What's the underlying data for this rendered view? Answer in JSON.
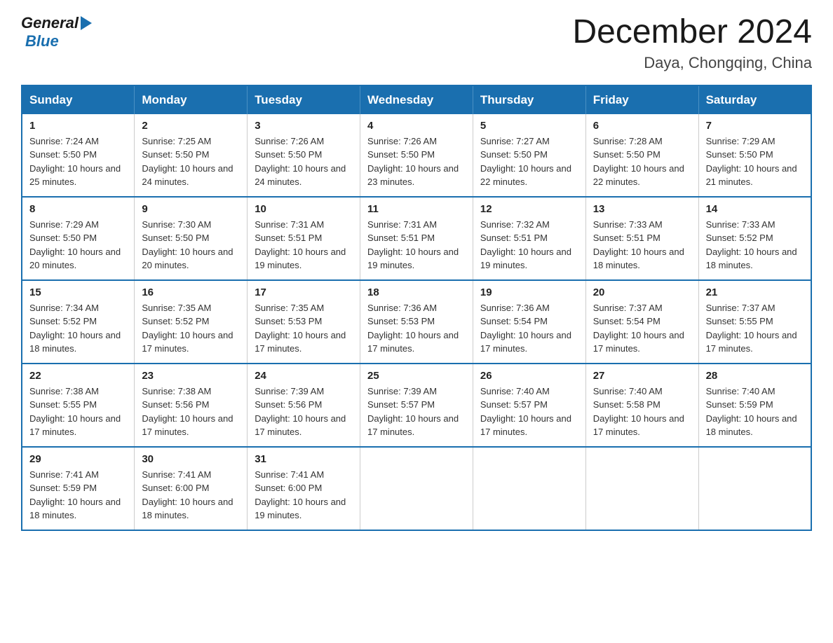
{
  "logo": {
    "general": "General",
    "blue": "Blue",
    "arrow": "▶"
  },
  "title": "December 2024",
  "subtitle": "Daya, Chongqing, China",
  "weekdays": [
    "Sunday",
    "Monday",
    "Tuesday",
    "Wednesday",
    "Thursday",
    "Friday",
    "Saturday"
  ],
  "weeks": [
    [
      {
        "day": "1",
        "sunrise": "7:24 AM",
        "sunset": "5:50 PM",
        "daylight": "10 hours and 25 minutes."
      },
      {
        "day": "2",
        "sunrise": "7:25 AM",
        "sunset": "5:50 PM",
        "daylight": "10 hours and 24 minutes."
      },
      {
        "day": "3",
        "sunrise": "7:26 AM",
        "sunset": "5:50 PM",
        "daylight": "10 hours and 24 minutes."
      },
      {
        "day": "4",
        "sunrise": "7:26 AM",
        "sunset": "5:50 PM",
        "daylight": "10 hours and 23 minutes."
      },
      {
        "day": "5",
        "sunrise": "7:27 AM",
        "sunset": "5:50 PM",
        "daylight": "10 hours and 22 minutes."
      },
      {
        "day": "6",
        "sunrise": "7:28 AM",
        "sunset": "5:50 PM",
        "daylight": "10 hours and 22 minutes."
      },
      {
        "day": "7",
        "sunrise": "7:29 AM",
        "sunset": "5:50 PM",
        "daylight": "10 hours and 21 minutes."
      }
    ],
    [
      {
        "day": "8",
        "sunrise": "7:29 AM",
        "sunset": "5:50 PM",
        "daylight": "10 hours and 20 minutes."
      },
      {
        "day": "9",
        "sunrise": "7:30 AM",
        "sunset": "5:50 PM",
        "daylight": "10 hours and 20 minutes."
      },
      {
        "day": "10",
        "sunrise": "7:31 AM",
        "sunset": "5:51 PM",
        "daylight": "10 hours and 19 minutes."
      },
      {
        "day": "11",
        "sunrise": "7:31 AM",
        "sunset": "5:51 PM",
        "daylight": "10 hours and 19 minutes."
      },
      {
        "day": "12",
        "sunrise": "7:32 AM",
        "sunset": "5:51 PM",
        "daylight": "10 hours and 19 minutes."
      },
      {
        "day": "13",
        "sunrise": "7:33 AM",
        "sunset": "5:51 PM",
        "daylight": "10 hours and 18 minutes."
      },
      {
        "day": "14",
        "sunrise": "7:33 AM",
        "sunset": "5:52 PM",
        "daylight": "10 hours and 18 minutes."
      }
    ],
    [
      {
        "day": "15",
        "sunrise": "7:34 AM",
        "sunset": "5:52 PM",
        "daylight": "10 hours and 18 minutes."
      },
      {
        "day": "16",
        "sunrise": "7:35 AM",
        "sunset": "5:52 PM",
        "daylight": "10 hours and 17 minutes."
      },
      {
        "day": "17",
        "sunrise": "7:35 AM",
        "sunset": "5:53 PM",
        "daylight": "10 hours and 17 minutes."
      },
      {
        "day": "18",
        "sunrise": "7:36 AM",
        "sunset": "5:53 PM",
        "daylight": "10 hours and 17 minutes."
      },
      {
        "day": "19",
        "sunrise": "7:36 AM",
        "sunset": "5:54 PM",
        "daylight": "10 hours and 17 minutes."
      },
      {
        "day": "20",
        "sunrise": "7:37 AM",
        "sunset": "5:54 PM",
        "daylight": "10 hours and 17 minutes."
      },
      {
        "day": "21",
        "sunrise": "7:37 AM",
        "sunset": "5:55 PM",
        "daylight": "10 hours and 17 minutes."
      }
    ],
    [
      {
        "day": "22",
        "sunrise": "7:38 AM",
        "sunset": "5:55 PM",
        "daylight": "10 hours and 17 minutes."
      },
      {
        "day": "23",
        "sunrise": "7:38 AM",
        "sunset": "5:56 PM",
        "daylight": "10 hours and 17 minutes."
      },
      {
        "day": "24",
        "sunrise": "7:39 AM",
        "sunset": "5:56 PM",
        "daylight": "10 hours and 17 minutes."
      },
      {
        "day": "25",
        "sunrise": "7:39 AM",
        "sunset": "5:57 PM",
        "daylight": "10 hours and 17 minutes."
      },
      {
        "day": "26",
        "sunrise": "7:40 AM",
        "sunset": "5:57 PM",
        "daylight": "10 hours and 17 minutes."
      },
      {
        "day": "27",
        "sunrise": "7:40 AM",
        "sunset": "5:58 PM",
        "daylight": "10 hours and 17 minutes."
      },
      {
        "day": "28",
        "sunrise": "7:40 AM",
        "sunset": "5:59 PM",
        "daylight": "10 hours and 18 minutes."
      }
    ],
    [
      {
        "day": "29",
        "sunrise": "7:41 AM",
        "sunset": "5:59 PM",
        "daylight": "10 hours and 18 minutes."
      },
      {
        "day": "30",
        "sunrise": "7:41 AM",
        "sunset": "6:00 PM",
        "daylight": "10 hours and 18 minutes."
      },
      {
        "day": "31",
        "sunrise": "7:41 AM",
        "sunset": "6:00 PM",
        "daylight": "10 hours and 19 minutes."
      },
      null,
      null,
      null,
      null
    ]
  ],
  "labels": {
    "sunrise": "Sunrise:",
    "sunset": "Sunset:",
    "daylight": "Daylight:"
  }
}
